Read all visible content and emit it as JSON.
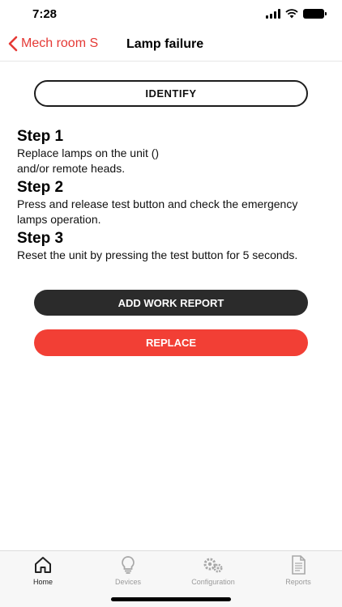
{
  "status": {
    "time": "7:28"
  },
  "nav": {
    "back_label": "Mech room S",
    "title": "Lamp failure"
  },
  "actions": {
    "identify_label": "IDENTIFY",
    "work_report_label": "ADD WORK REPORT",
    "replace_label": "REPLACE"
  },
  "steps": [
    {
      "title": "Step 1",
      "text": "Replace lamps on the unit () and/or remote heads."
    },
    {
      "title": "Step 2",
      "text": "Press and release test button and check the emergency lamps operation."
    },
    {
      "title": "Step 3",
      "text": "Reset the unit by pressing the test button for 5 seconds."
    }
  ],
  "tabs": [
    {
      "label": "Home",
      "icon": "home-icon",
      "active": true
    },
    {
      "label": "Devices",
      "icon": "lightbulb-icon",
      "active": false
    },
    {
      "label": "Configuration",
      "icon": "gears-icon",
      "active": false
    },
    {
      "label": "Reports",
      "icon": "document-icon",
      "active": false
    }
  ],
  "colors": {
    "accent": "#f23f35",
    "dark_button": "#2b2b2b"
  }
}
